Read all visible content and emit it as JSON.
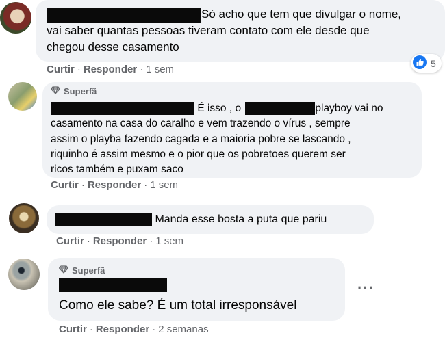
{
  "comments": [
    {
      "badge": "",
      "text_lines": [
        "Só acho que tem que divulgar o nome,",
        "vai saber quantas pessoas tiveram contato com ele desde que",
        "chegou desse casamento"
      ],
      "like": "Curtir",
      "reply": "Responder",
      "time": "1 sem",
      "reaction_count": "5"
    },
    {
      "badge": "Superfã",
      "line1_a": "É isso , o",
      "line1_b": "playboy vai no",
      "text_lines": [
        "casamento na casa do caralho e vem trazendo o vírus , sempre",
        "assim o playba fazendo cagada e a maioria pobre se lascando ,",
        "riquinho é assim mesmo e o pior que os pobretoes querem ser",
        "ricos também e puxam saco"
      ],
      "like": "Curtir",
      "reply": "Responder",
      "time": "1 sem"
    },
    {
      "badge": "",
      "text": "Manda esse bosta a puta que pariu",
      "like": "Curtir",
      "reply": "Responder",
      "time": "1 sem"
    },
    {
      "badge": "Superfã",
      "text": "Como ele sabe? É um total irresponsável",
      "like": "Curtir",
      "reply": "Responder",
      "time": "2 semanas",
      "more": "···"
    }
  ],
  "colors": {
    "bubble": "#f0f2f5",
    "meta": "#65676b",
    "like_blue": "#1877f2",
    "redaction": "#0a0a0a"
  },
  "icons": {
    "badge": "diamond-icon",
    "reaction": "thumbs-up-icon",
    "menu": "more-options-icon"
  }
}
